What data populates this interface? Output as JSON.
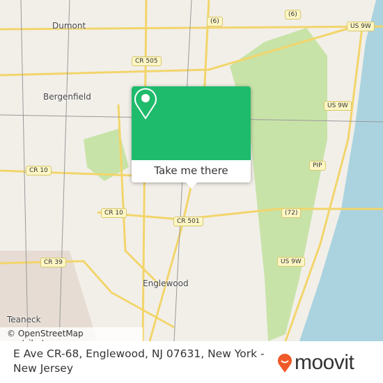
{
  "map": {
    "places": [
      "Dumont",
      "Bergenfield",
      "Englewood",
      "Teaneck"
    ],
    "road_shields": [
      "(6)",
      "(6)",
      "US 9W",
      "CR 505",
      "US 9W",
      "PIP",
      "CR 10",
      "CR 10",
      "(72)",
      "CR 501",
      "CR 39",
      "US 9W"
    ],
    "attribution": "© OpenStreetMap contributors",
    "colors": {
      "land": "#f2efe9",
      "park": "#c8e3a8",
      "water": "#aad3df",
      "road": "#f7e98e"
    }
  },
  "popup": {
    "icon": "map-pin-icon",
    "button_label": "Take me there",
    "color": "#1fbb6c"
  },
  "footer": {
    "address": "E Ave CR-68, Englewood, NJ 07631, New York - New Jersey",
    "brand": "moovit",
    "brand_color": "#f05a28"
  }
}
